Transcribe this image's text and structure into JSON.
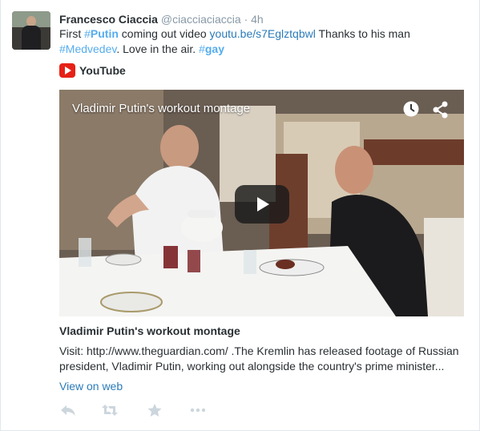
{
  "tweet": {
    "fullname": "Francesco Ciaccia",
    "handle": "@ciacciaciaccia",
    "separator": "·",
    "time": "4h",
    "text": {
      "part1": "First ",
      "hashtag1": "#Putin",
      "part2": " coming out video ",
      "link": "youtu.be/s7Eglztqbwl",
      "part3": " Thanks to his man ",
      "hashtag2": "#Medvedev",
      "part4": ". Love in the air. ",
      "hashtag3": "#gay"
    }
  },
  "card": {
    "provider": "YouTube",
    "video_title": "Vladimir Putin's workout montage",
    "title": "Vladimir Putin's workout montage",
    "description": "Visit: http://www.theguardian.com/ .The Kremlin has released footage of Russian president, Vladimir Putin, working out alongside the country's prime minister...",
    "view_on_web": "View on web"
  },
  "actions": {
    "icons": [
      "reply-icon",
      "retweet-icon",
      "favorite-icon",
      "more-icon"
    ],
    "icon_color": "#ccd6dd"
  },
  "colors": {
    "hashtag": "#55acee",
    "link": "#2b7bb9",
    "youtube_red": "#e62117",
    "meta_gray": "#8899a6"
  }
}
